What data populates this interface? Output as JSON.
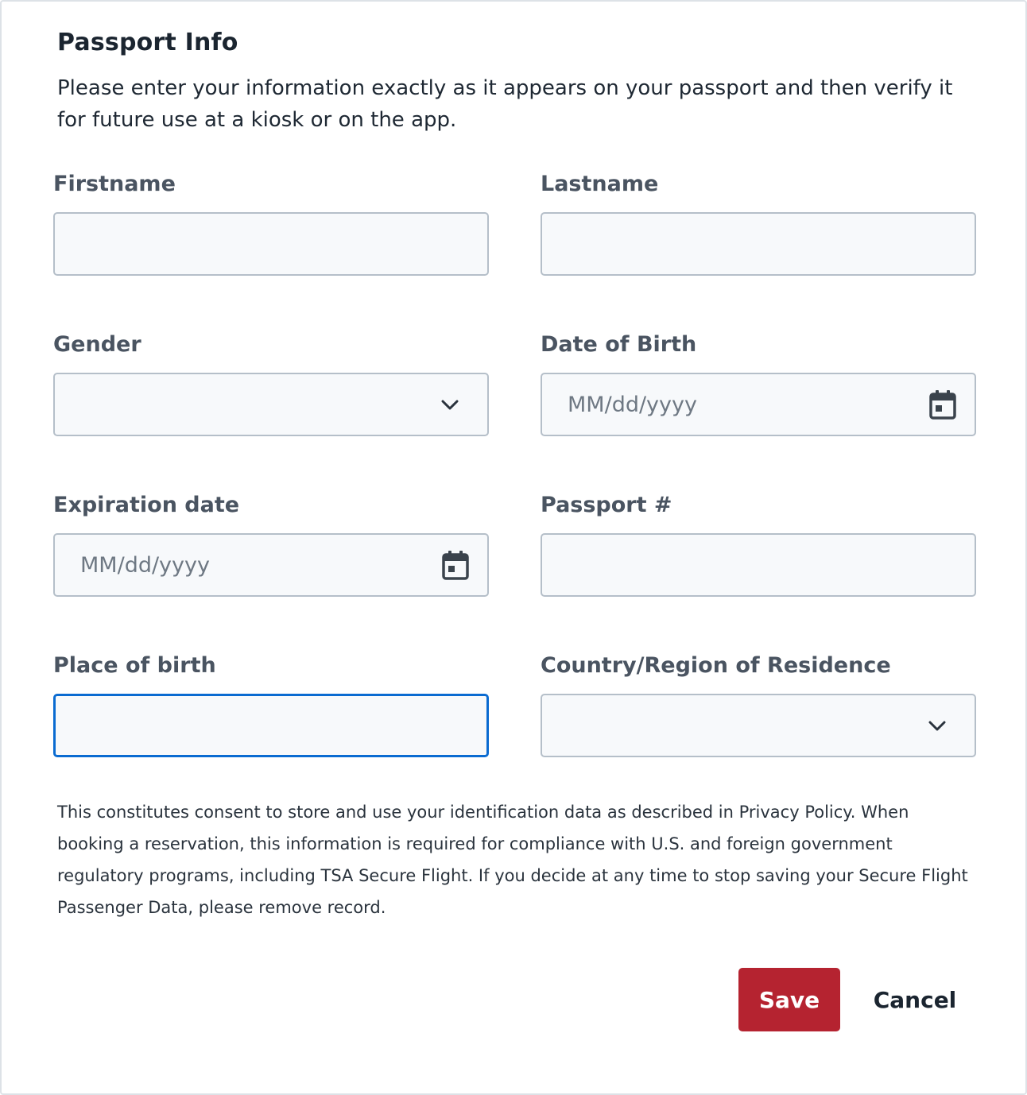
{
  "header": {
    "title": "Passport Info",
    "intro": "Please enter your information exactly as it appears on your passport and then verify it for future use at a kiosk or on the app."
  },
  "form": {
    "firstname": {
      "label": "Firstname",
      "value": ""
    },
    "lastname": {
      "label": "Lastname",
      "value": ""
    },
    "gender": {
      "label": "Gender",
      "selected": "",
      "icon": "chevron-down-icon"
    },
    "dob": {
      "label": "Date of Birth",
      "placeholder": "MM/dd/yyyy",
      "icon": "calendar-icon"
    },
    "expiration": {
      "label": "Expiration date",
      "placeholder": "MM/dd/yyyy",
      "icon": "calendar-icon"
    },
    "passport_number": {
      "label": "Passport #",
      "value": ""
    },
    "place_of_birth": {
      "label": "Place of birth",
      "value": "",
      "focused": true
    },
    "country": {
      "label": "Country/Region of Residence",
      "selected": "",
      "icon": "chevron-down-icon"
    }
  },
  "consent": {
    "text": "This constitutes consent to store and use your identification data as described in Privacy Policy. When booking a reservation, this information is required for compliance with U.S. and foreign government regulatory programs, including TSA Secure Flight. If you decide at any time to stop saving your Secure Flight Passenger Data, please remove record."
  },
  "actions": {
    "save_label": "Save",
    "cancel_label": "Cancel"
  },
  "colors": {
    "primary_button": "#b52330",
    "focus_border": "#0a6bd1",
    "field_border": "#b5bfc9",
    "field_background": "#f7f9fb",
    "label_text": "#4a5461"
  }
}
